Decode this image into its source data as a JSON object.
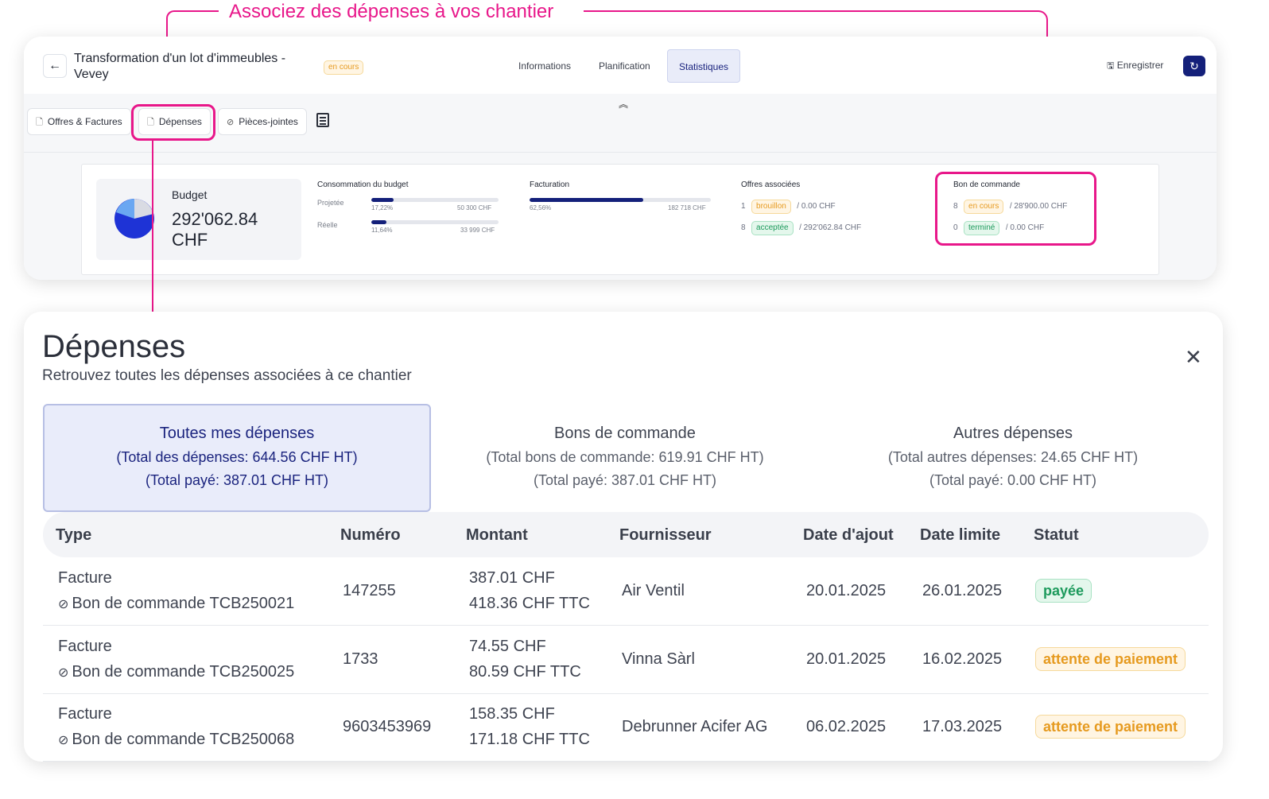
{
  "callout": {
    "text": "Associez des dépenses à vos chantier"
  },
  "header": {
    "project_title": "Transformation d'un lot d'immeubles - Vevey",
    "status_badge": "en cours",
    "tabs": [
      "Informations",
      "Planification",
      "Statistiques"
    ],
    "active_tab": "Statistiques",
    "save_label": "Enregistrer",
    "back_icon": "arrow-left-icon",
    "refresh_icon": "refresh-icon"
  },
  "subnav": {
    "buttons": [
      {
        "label": "Offres & Factures",
        "icon": "document-icon"
      },
      {
        "label": "Dépenses",
        "icon": "document-icon"
      },
      {
        "label": "Pièces-jointes",
        "icon": "paperclip-icon"
      }
    ],
    "notes_icon": "list-document-icon",
    "collapse_icon": "chevrons-up-icon"
  },
  "stats": {
    "budget": {
      "label": "Budget",
      "value": "292'062.84 CHF",
      "pie_fraction": 0.1722
    },
    "consumption": {
      "title": "Consommation du budget",
      "rows": [
        {
          "label": "Projetée",
          "percent_text": "17,22%",
          "amount": "50 300 CHF",
          "fill": 0.1722
        },
        {
          "label": "Réelle",
          "percent_text": "11,64%",
          "amount": "33 999 CHF",
          "fill": 0.1164
        }
      ]
    },
    "billing": {
      "title": "Facturation",
      "percent_text": "62,56%",
      "amount": "182 718 CHF",
      "fill": 0.6256
    },
    "offers": {
      "title": "Offres associées",
      "rows": [
        {
          "count": "1",
          "badge": "brouillon",
          "badge_color": "orange",
          "amount": "/ 0.00 CHF"
        },
        {
          "count": "8",
          "badge": "acceptée",
          "badge_color": "green",
          "amount": "/ 292'062.84 CHF"
        }
      ]
    },
    "purchase_orders": {
      "title": "Bon de commande",
      "rows": [
        {
          "count": "8",
          "badge": "en cours",
          "badge_color": "orange",
          "amount": "/ 28'900.00 CHF"
        },
        {
          "count": "0",
          "badge": "terminé",
          "badge_color": "green",
          "amount": "/ 0.00 CHF"
        }
      ]
    }
  },
  "expenses": {
    "title": "Dépenses",
    "subtitle": "Retrouvez toutes les dépenses associées à ce chantier",
    "summary_tabs": [
      {
        "title": "Toutes mes dépenses",
        "total": "(Total des dépenses: 644.56 CHF HT)",
        "paid": "(Total payé: 387.01 CHF HT)",
        "active": true
      },
      {
        "title": "Bons de commande",
        "total": "(Total bons de commande: 619.91 CHF HT)",
        "paid": "(Total payé: 387.01 CHF HT)",
        "active": false
      },
      {
        "title": "Autres dépenses",
        "total": "(Total autres dépenses: 24.65 CHF HT)",
        "paid": "(Total payé: 0.00 CHF HT)",
        "active": false
      }
    ],
    "columns": [
      "Type",
      "Numéro",
      "Montant",
      "Fournisseur",
      "Date d'ajout",
      "Date limite",
      "Statut"
    ],
    "rows": [
      {
        "type": "Facture",
        "link": "Bon de commande TCB250021",
        "number": "147255",
        "amount_ht": "387.01 CHF",
        "amount_ttc": "418.36 CHF TTC",
        "supplier": "Air Ventil",
        "added": "20.01.2025",
        "due": "26.01.2025",
        "status": "payée",
        "status_color": "green"
      },
      {
        "type": "Facture",
        "link": "Bon de commande TCB250025",
        "number": "1733",
        "amount_ht": "74.55 CHF",
        "amount_ttc": "80.59 CHF TTC",
        "supplier": "Vinna Sàrl",
        "added": "20.01.2025",
        "due": "16.02.2025",
        "status": "attente de paiement",
        "status_color": "orange"
      },
      {
        "type": "Facture",
        "link": "Bon de commande TCB250068",
        "number": "9603453969",
        "amount_ht": "158.35 CHF",
        "amount_ttc": "171.18 CHF TTC",
        "supplier": "Debrunner Acifer AG",
        "added": "06.02.2025",
        "due": "17.03.2025",
        "status": "attente de paiement",
        "status_color": "orange"
      }
    ]
  },
  "colors": {
    "accent": "#e8178a",
    "primary": "#14207a",
    "active_tab_bg": "#e9ecfa"
  }
}
